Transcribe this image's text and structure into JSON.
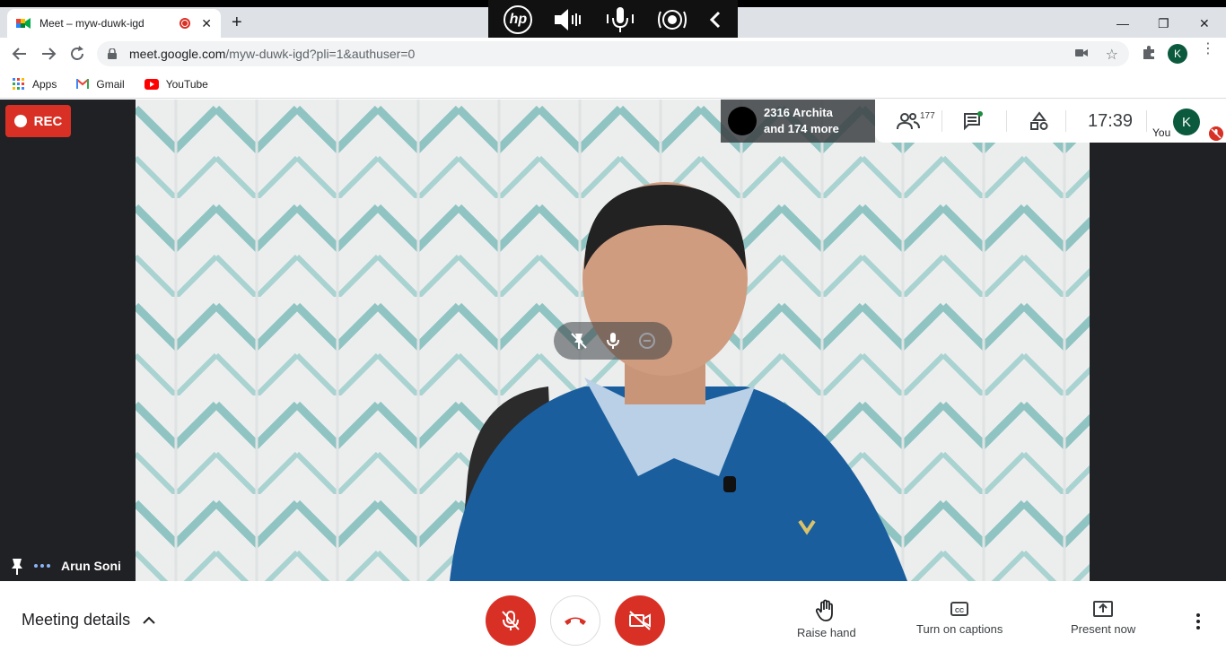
{
  "browser": {
    "tab_title": "Meet – myw-duwk-igd",
    "url_host": "meet.google.com",
    "url_path": "/myw-duwk-igd?pli=1&authuser=0",
    "profile_initial": "K",
    "bookmarks": [
      {
        "label": "Apps",
        "icon": "apps-grid-icon"
      },
      {
        "label": "Gmail",
        "icon": "gmail-icon"
      },
      {
        "label": "YouTube",
        "icon": "youtube-icon"
      }
    ]
  },
  "hp_overlay": {
    "logo": "hp"
  },
  "meet": {
    "rec_label": "REC",
    "presenter_line1": "2316 Archita",
    "presenter_line2": "and 174 more",
    "participant_count": "177",
    "clock": "17:39",
    "you_label": "You",
    "you_initial": "K",
    "speaker_name": "Arun Soni",
    "meeting_details_label": "Meeting details",
    "raise_hand_label": "Raise hand",
    "captions_label": "Turn on captions",
    "present_label": "Present now"
  },
  "colors": {
    "danger": "#d93025",
    "meet_dark": "#202124",
    "avatar_green": "#0b5a3e"
  }
}
